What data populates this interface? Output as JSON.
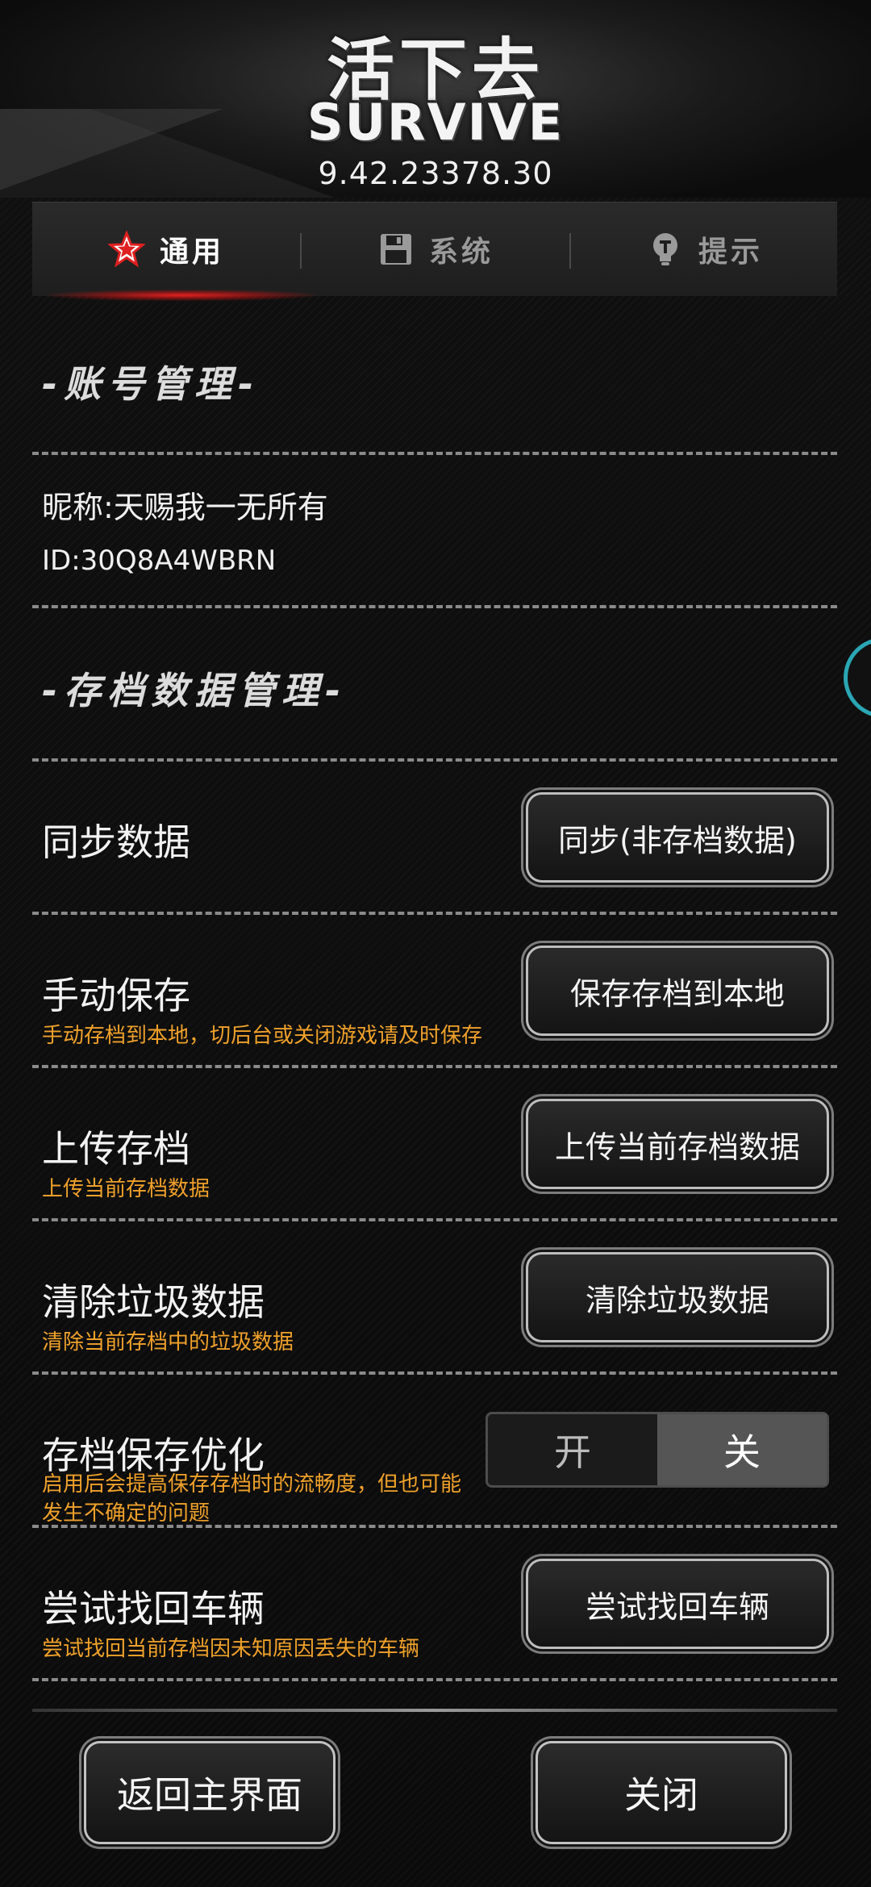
{
  "header": {
    "logo_cn": "活下去",
    "logo_en": "SURVIVE",
    "version": "9.42.23378.30"
  },
  "tabs": [
    {
      "label": "通用",
      "icon": "star-icon",
      "active": true
    },
    {
      "label": "系统",
      "icon": "save-disk-icon",
      "active": false
    },
    {
      "label": "提示",
      "icon": "lightbulb-icon",
      "active": false
    }
  ],
  "account": {
    "section_title": "-账号管理-",
    "nickname": "昵称:天赐我一无所有",
    "id": "ID:30Q8A4WBRN"
  },
  "save_data": {
    "section_title": "-存档数据管理-",
    "rows": [
      {
        "title": "同步数据",
        "desc": "",
        "button": "同步(非存档数据)"
      },
      {
        "title": "手动保存",
        "desc": "手动存档到本地，切后台或关闭游戏请及时保存",
        "button": "保存存档到本地"
      },
      {
        "title": "上传存档",
        "desc": "上传当前存档数据",
        "button": "上传当前存档数据"
      },
      {
        "title": "清除垃圾数据",
        "desc": "清除当前存档中的垃圾数据",
        "button": "清除垃圾数据"
      },
      {
        "title": "存档保存优化",
        "desc": "启用后会提高保存存档时的流畅度，但也可能发生不确定的问题",
        "toggle_on": "开",
        "toggle_off": "关",
        "selected": "关"
      },
      {
        "title": "尝试找回车辆",
        "desc": "尝试找回当前存档因未知原因丢失的车辆",
        "button": "尝试找回车辆"
      }
    ]
  },
  "footer": {
    "back_label": "返回主界面",
    "close_label": "关闭"
  },
  "colors": {
    "accent_red": "#e02020",
    "desc_orange": "#f0a12a",
    "edge_cyan": "#2aa6b4"
  }
}
